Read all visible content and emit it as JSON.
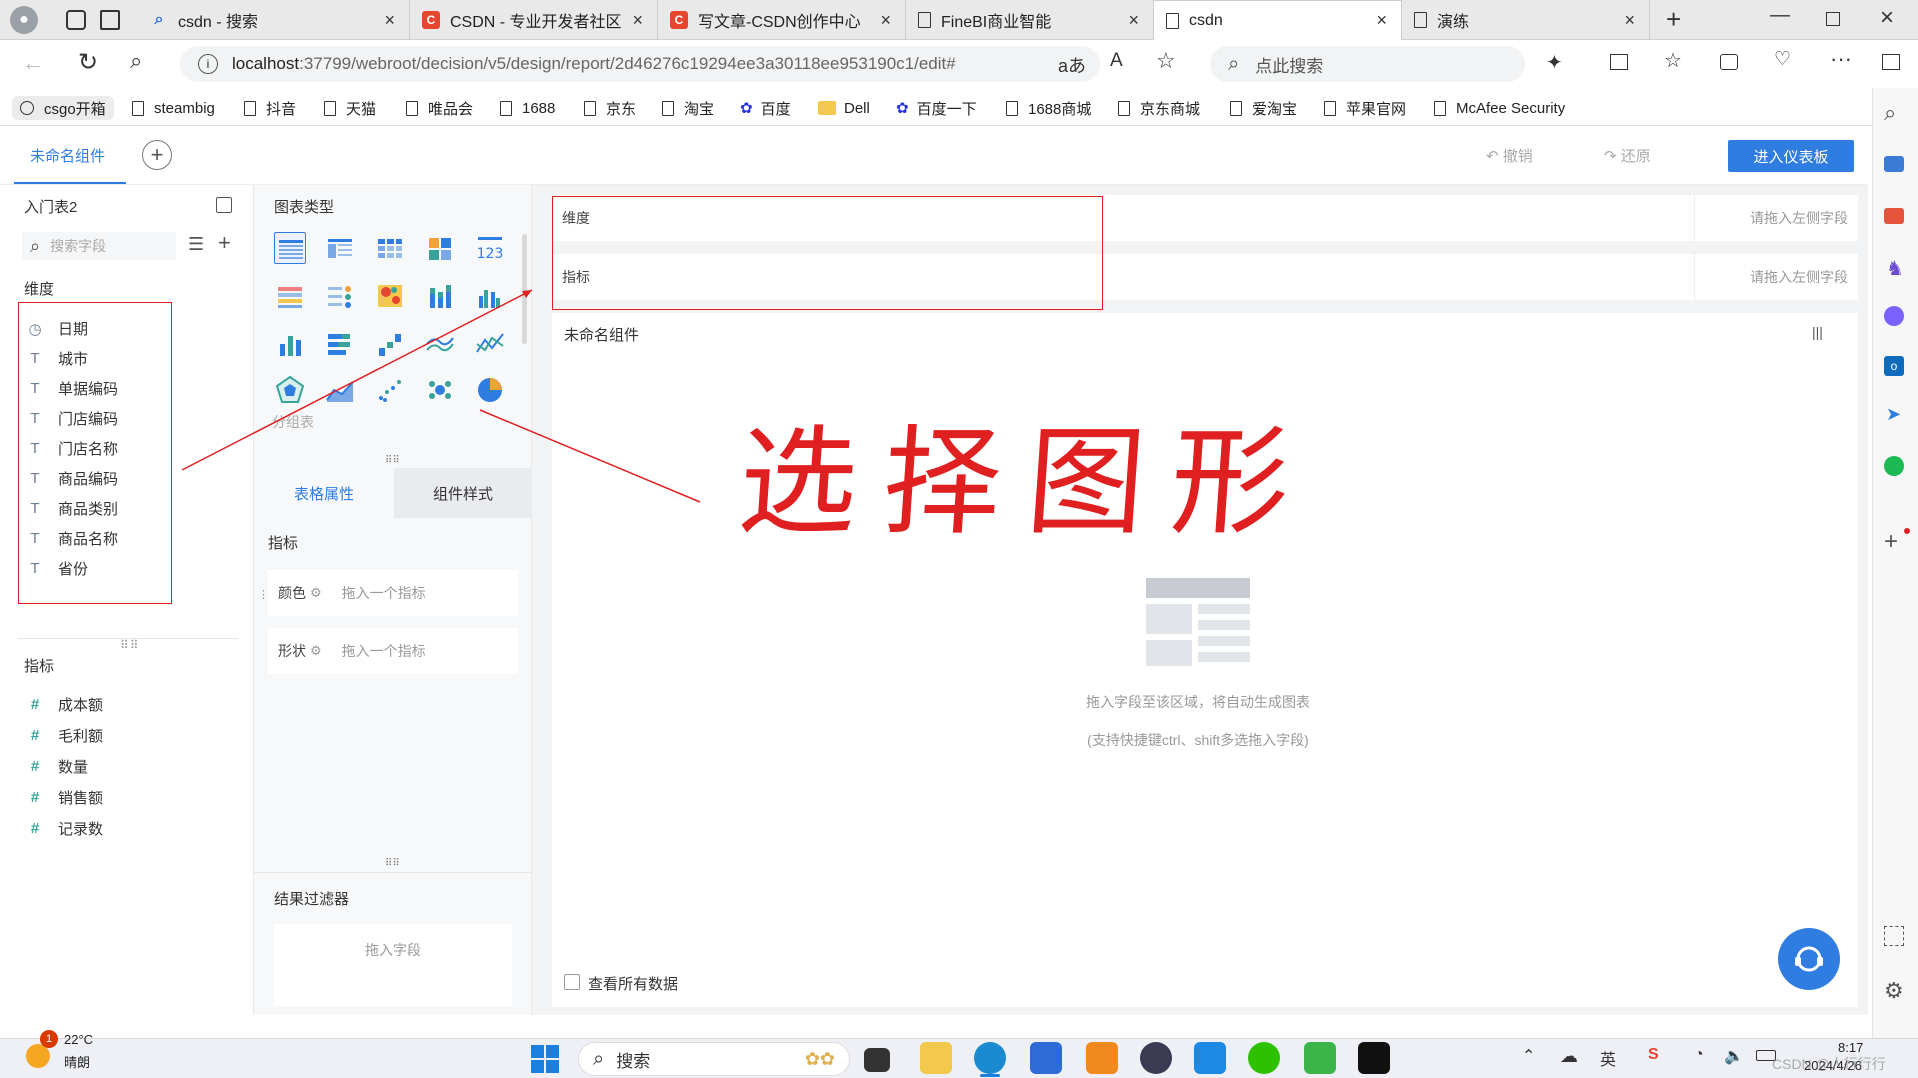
{
  "browser": {
    "tabs": [
      {
        "title": "csdn - 搜索",
        "icon": "search-icon"
      },
      {
        "title": "CSDN - 专业开发者社区",
        "icon": "csdn-c-icon"
      },
      {
        "title": "写文章-CSDN创作中心",
        "icon": "csdn-c-icon"
      },
      {
        "title": "FineBI商业智能",
        "icon": "page-icon"
      },
      {
        "title": "csdn",
        "icon": "page-icon"
      },
      {
        "title": "演练",
        "icon": "page-icon"
      }
    ],
    "url_host": "localhost",
    "url_rest": ":37799/webroot/decision/v5/design/report/2d46276c19294ee3a30118ee953190c1/edit#",
    "search_placeholder": "点此搜索",
    "bookmarks": [
      "csgo开箱",
      "steambig",
      "抖音",
      "天猫",
      "唯品会",
      "1688",
      "京东",
      "淘宝",
      "百度",
      "Dell",
      "百度一下",
      "1688商城",
      "京东商城",
      "爱淘宝",
      "苹果官网",
      "McAfee Security"
    ]
  },
  "app": {
    "component_tab": "未命名组件",
    "undo": "撤销",
    "redo": "还原",
    "enter_dashboard": "进入仪表板",
    "table_name": "入门表2",
    "field_search_placeholder": "搜索字段",
    "dimension_title": "维度",
    "dimensions": [
      {
        "name": "日期",
        "icon": "clock-icon"
      },
      {
        "name": "城市",
        "icon": "text-icon"
      },
      {
        "name": "单据编码",
        "icon": "text-icon"
      },
      {
        "name": "门店编码",
        "icon": "text-icon"
      },
      {
        "name": "门店名称",
        "icon": "text-icon"
      },
      {
        "name": "商品编码",
        "icon": "text-icon"
      },
      {
        "name": "商品类别",
        "icon": "text-icon"
      },
      {
        "name": "商品名称",
        "icon": "text-icon"
      },
      {
        "name": "省份",
        "icon": "text-icon"
      }
    ],
    "measure_title": "指标",
    "measures": [
      "成本额",
      "毛利额",
      "数量",
      "销售额",
      "记录数"
    ],
    "chart_type_title": "图表类型",
    "grouped_table_label": "分组表",
    "tab_table_attr": "表格属性",
    "tab_component_style": "组件样式",
    "attr_measure_title": "指标",
    "color_label": "颜色",
    "shape_label": "形状",
    "drop_measure_hint": "拖入一个指标",
    "result_filter_title": "结果过滤器",
    "drop_field_hint": "拖入字段",
    "dim_drop_label": "维度",
    "measure_drop_label": "指标",
    "drop_left_hint": "请拖入左侧字段",
    "canvas_title": "未命名组件",
    "empty_line1": "拖入字段至该区域，将自动生成图表",
    "empty_line2": "(支持快捷键ctrl、shift多选拖入字段)",
    "view_all_data": "查看所有数据",
    "annotation": "选择图形"
  },
  "taskbar": {
    "weather_temp": "22°C",
    "weather_desc": "晴朗",
    "weather_badge": "1",
    "search_label": "搜索",
    "time": "8:17",
    "date": "2024/4/26",
    "watermark": "CSDN @人行行行"
  },
  "colors": {
    "accent": "#2f7de1",
    "annotation_red": "#e02020",
    "measure_icon": "#38a39a"
  }
}
